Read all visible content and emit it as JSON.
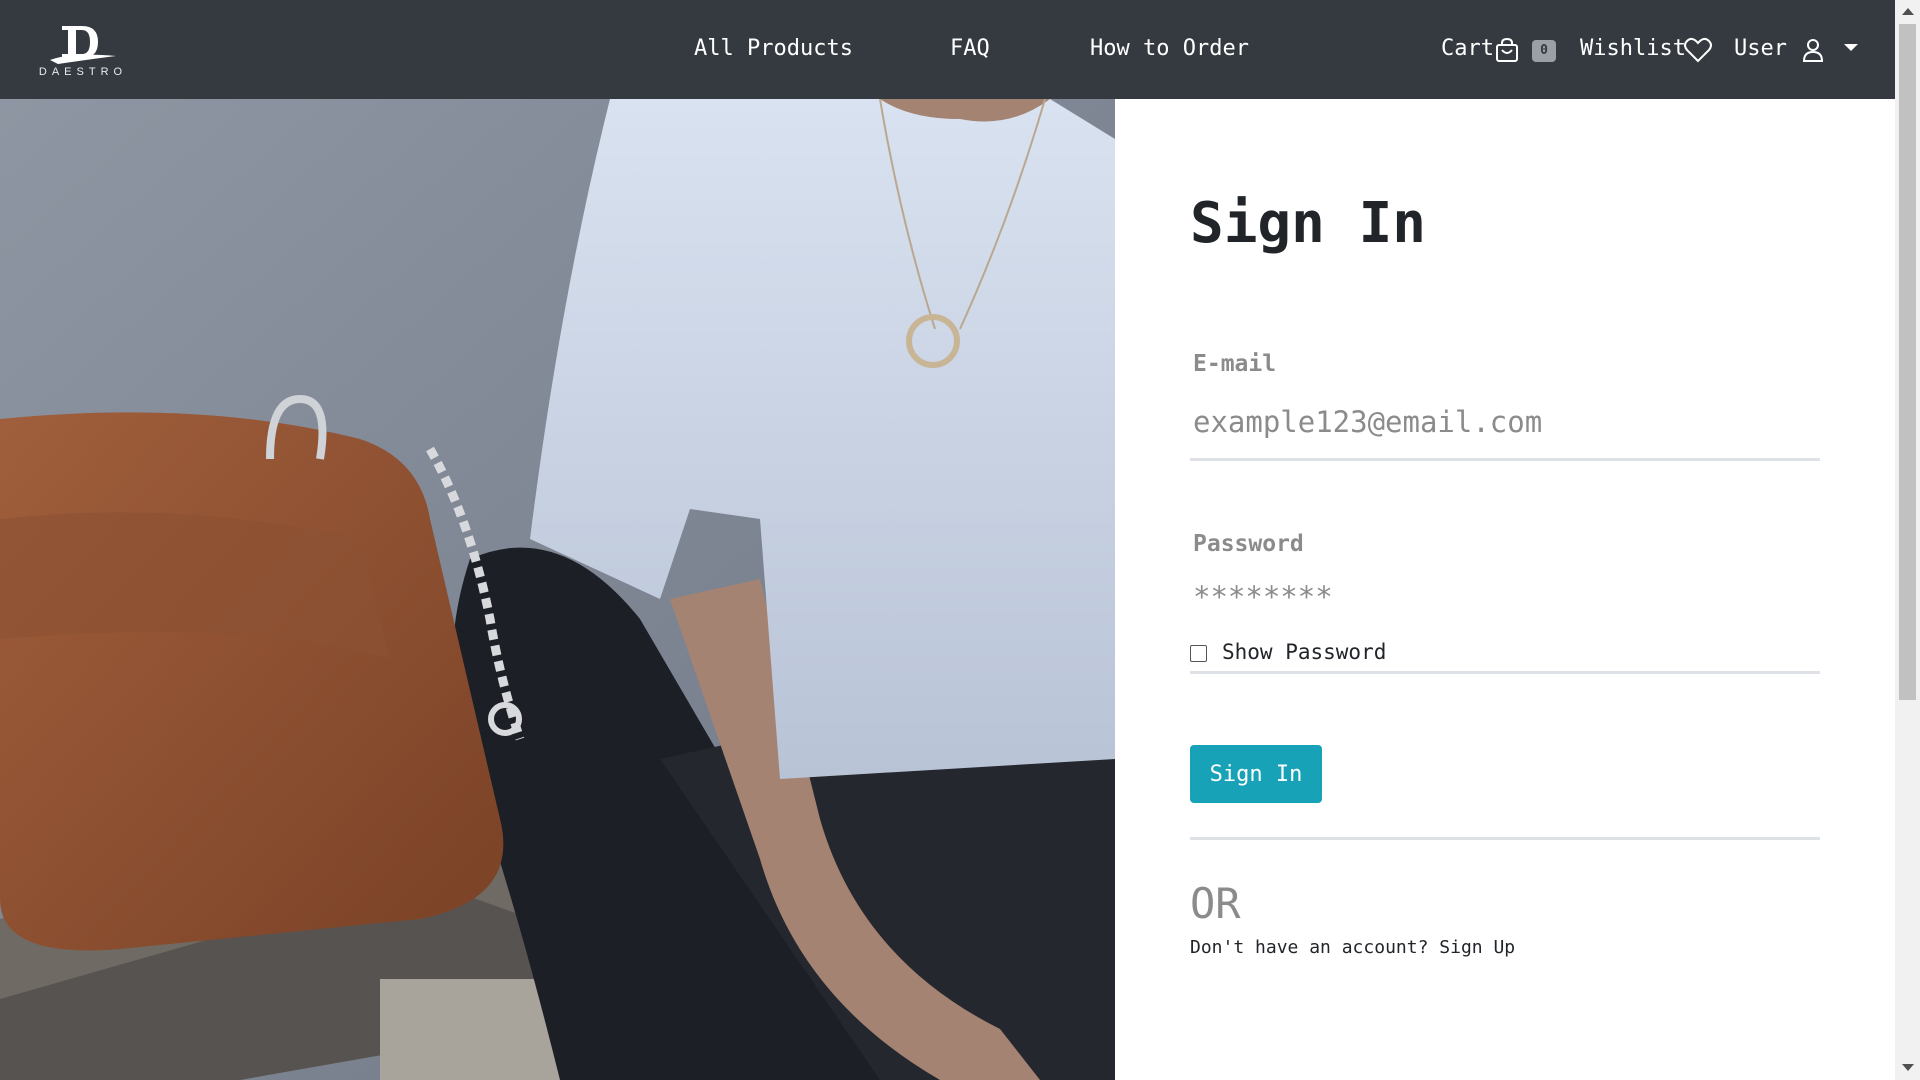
{
  "brand": {
    "logo_letter": "D",
    "logo_text": "DAESTRO"
  },
  "nav": {
    "links": [
      {
        "label": "All Products"
      },
      {
        "label": "FAQ"
      },
      {
        "label": "How to Order"
      }
    ],
    "cart_label": "Cart",
    "cart_count": "0",
    "wishlist_label": "Wishlist",
    "user_label": "User"
  },
  "icons": {
    "cart": "shopping-bag-icon",
    "wishlist": "heart-icon",
    "user": "user-icon",
    "dropdown": "caret-down-icon"
  },
  "form": {
    "title": "Sign In",
    "email_label": "E-mail",
    "email_placeholder": "example123@email.com",
    "email_value": "",
    "password_label": "Password",
    "password_placeholder": "********",
    "password_value": "",
    "show_password_label": "Show Password",
    "show_password_checked": false,
    "submit_label": "Sign In",
    "or_text": "OR",
    "signup_prompt": "Don't have an account?",
    "signup_link": "Sign Up"
  },
  "colors": {
    "navbar_bg": "#343a40",
    "accent": "#17a2b8",
    "muted_text": "#8b8b8b"
  }
}
